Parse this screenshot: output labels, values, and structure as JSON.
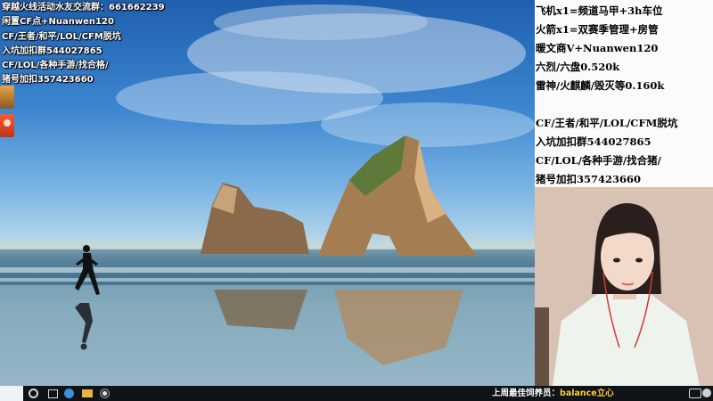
{
  "overlay_left": {
    "line1": "穿越火线活动水友交流群：661662239",
    "line2": "闲置CF点+Nuanwen120",
    "line3": "CF/王者/和平/LOL/CFM脱坑",
    "line4": "入坑加扣群544027865",
    "line5": "CF/LOL/各种手游/找合格/",
    "line6": "猪号加扣357423660"
  },
  "info_panel": {
    "lines": [
      "飞机x1=频道马甲+3h车位",
      "火箭x1=双赛季管理+房管",
      "暖文商V+Nuanwen120",
      "六烈/六盘0.520k",
      "雷神/火麒麟/毁灭等0.160k",
      "CF/王者/和平/LOL/CFM脱坑",
      "入坑加扣群544027865",
      "CF/LOL/各种手游/找合猪/",
      "猪号加扣357423660"
    ]
  },
  "ticker": {
    "label": "上周最佳饲养员：",
    "value": "balance立心"
  },
  "icons": {
    "taskbar": [
      "search-icon",
      "task-view-icon",
      "edge-icon",
      "folder-icon",
      "app-icon"
    ],
    "tray": [
      "chat-icon",
      "ball-icon"
    ]
  },
  "colors": {
    "ticker_accent": "#ffd23a",
    "taskbar": "#101418",
    "panel_bg": "#fbfbfb"
  }
}
